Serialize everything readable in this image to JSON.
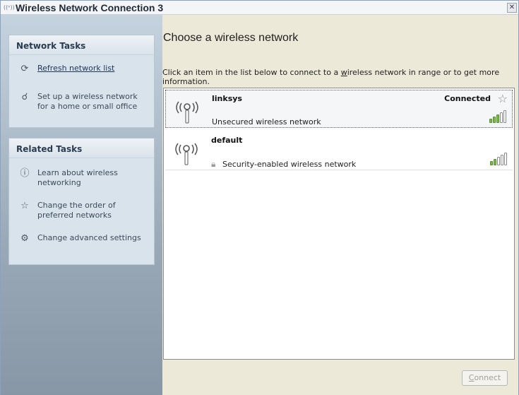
{
  "window": {
    "title": "Wireless Network Connection 3",
    "title_icon": "wireless-signal-icon",
    "close_glyph": "✕"
  },
  "sidebar": {
    "network_tasks": {
      "heading": "Network Tasks",
      "items": [
        {
          "label": "Refresh network list",
          "icon": "refresh-icon",
          "link": true
        },
        {
          "label": "Set up a wireless network for a home or small office",
          "icon": "setup-wizard-icon",
          "link": false
        }
      ]
    },
    "related_tasks": {
      "heading": "Related Tasks",
      "items": [
        {
          "label": "Learn about wireless networking",
          "icon": "info-icon"
        },
        {
          "label": "Change the order of preferred networks",
          "icon": "star-icon"
        },
        {
          "label": "Change advanced settings",
          "icon": "settings-icon"
        }
      ]
    }
  },
  "main": {
    "title": "Choose a wireless network",
    "instructions_before": "Click an item in the list below to connect to a ",
    "instructions_underlined": "w",
    "instructions_after": "ireless network in range or to get more information."
  },
  "networks": [
    {
      "name": "linksys",
      "status": "Connected",
      "security": "Unsecured wireless network",
      "signal_bars": 5,
      "signal_strength": "3/5",
      "selected": true,
      "secure": false
    },
    {
      "name": "default",
      "status": "",
      "security": "Security-enabled wireless network",
      "signal_bars": 5,
      "signal_strength": "2/5",
      "selected": false,
      "secure": true
    }
  ],
  "buttons": {
    "connect_prefix": "",
    "connect_accel": "C",
    "connect_rest": "onnect",
    "connect_enabled": false
  },
  "colors": {
    "signal_on": "#7bbf3a",
    "signal_off": "#ffffff",
    "sidebar_panel": "#d9e3ec"
  }
}
